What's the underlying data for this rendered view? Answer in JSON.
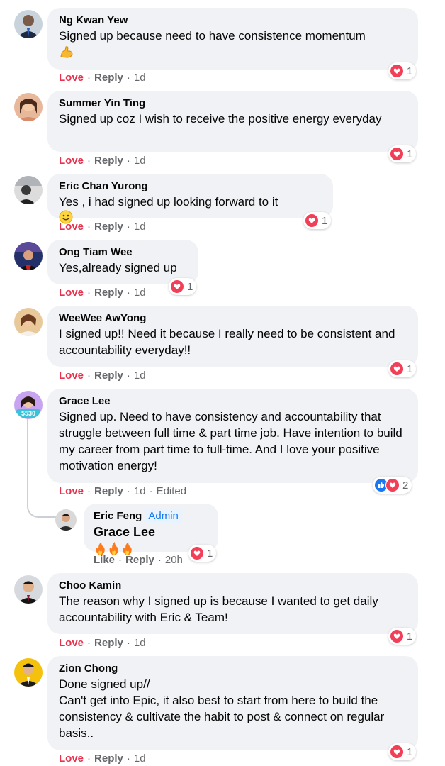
{
  "colors": {
    "love": "#e8324d",
    "bubble": "#f0f2f5",
    "meta": "#65676b",
    "heart": "#f33e58",
    "like": "#1877f2"
  },
  "labels": {
    "love": "Love",
    "like": "Like",
    "reply": "Reply",
    "admin": "Admin"
  },
  "comments": [
    {
      "name": "Ng Kwan Yew",
      "text": "Signed up because need to have consistence momentum",
      "time": "1d",
      "reactions": "1",
      "emoji": "flexed-biceps"
    },
    {
      "name": "Summer Yin Ting",
      "text": "Signed up coz I wish to receive the positive energy everyday",
      "time": "1d",
      "reactions": "1"
    },
    {
      "name": "Eric Chan Yurong",
      "text": "Yes , i had signed up looking forward to it",
      "time": "1d",
      "reactions": "1",
      "emoji": "smiling-face"
    },
    {
      "name": "Ong Tiam Wee",
      "text": "Yes,already signed up",
      "time": "1d",
      "reactions": "1"
    },
    {
      "name": "WeeWee AwYong",
      "text": "I signed up!! Need it because I really need to be consistent and accountability everyday!!",
      "time": "1d",
      "reactions": "1"
    },
    {
      "name": "Grace Lee",
      "text": "Signed up. Need to have consistency and accountability that struggle between full time & part time job. Have intention to build my career from part time to full-time. And I love your positive motivation energy!",
      "time": "1d",
      "edited": "Edited",
      "reactions": "2"
    },
    {
      "name": "Choo Kamin",
      "text": "The reason why I signed up is because I wanted to get daily accountability with Eric & Team!",
      "time": "1d",
      "reactions": "1"
    },
    {
      "name": "Zion Chong",
      "text": "Done signed up//\nCan't get into Epic, it also best to start from here to build the consistency & cultivate the habit to post & connect on regular basis..",
      "time": "1d",
      "reactions": "1"
    }
  ],
  "reply": {
    "name": "Eric Feng",
    "text": "Grace Lee",
    "time": "20h",
    "reactions": "1",
    "emoji": "fire"
  }
}
